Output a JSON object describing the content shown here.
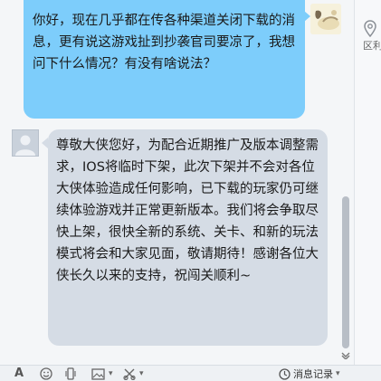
{
  "side_panel": {
    "location_label": "区利"
  },
  "messages": [
    {
      "sender": "me",
      "text": "你好，现在几乎都在传各种渠道关闭下载的消息，更有说这游戏扯到抄袭官司要凉了，我想问下什么情况？有没有啥说法？"
    },
    {
      "sender": "support",
      "text": "尊敬大侠您好，为配合近期推广及版本调整需求，IOS将临时下架，此次下架并不会对各位大侠体验造成任何影响，已下载的玩家仍可继续体验游戏并正常更新版本。我们将会争取尽快上架，很快全新的系统、关卡、和新的玩法模式将会和大家见面，敬请期待！感谢各位大侠长久以来的支持，祝闯关顺利~"
    }
  ],
  "toolbar": {
    "font_icon": "A",
    "history_label": "消息记录"
  },
  "colors": {
    "my_bubble": "#7dcdfb",
    "their_bubble": "#d5dce5"
  }
}
